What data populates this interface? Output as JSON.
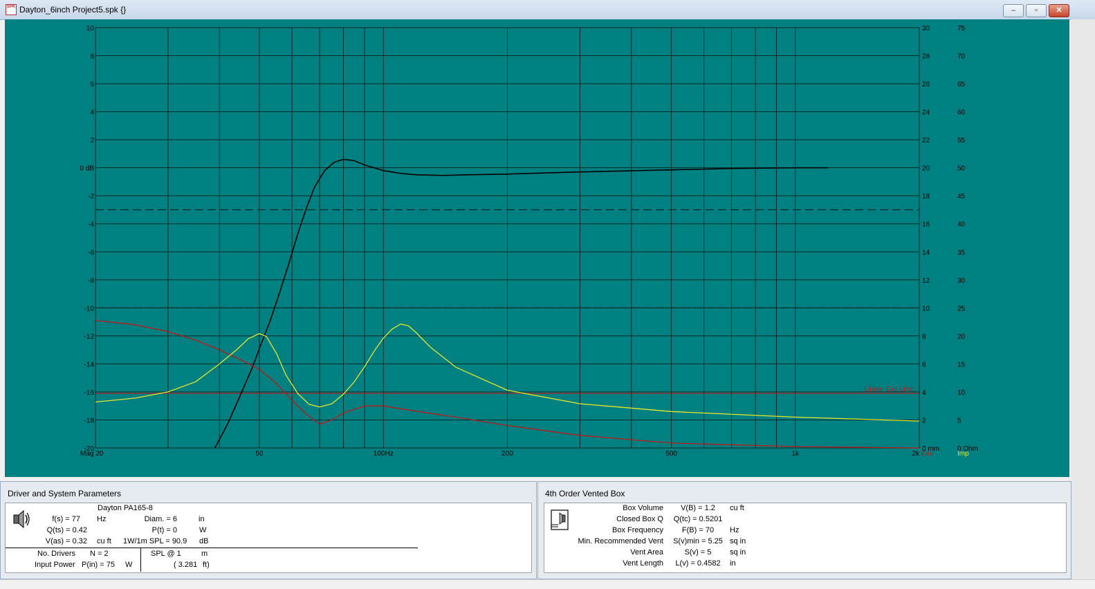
{
  "window": {
    "title": "Dayton_6inch Project5.spk {}",
    "minimize": "–",
    "restore": "▫",
    "close": "✕",
    "icon_text": "SPK"
  },
  "chart_data": {
    "type": "line",
    "x_scale": "log",
    "xlim": [
      20,
      2000
    ],
    "x_tick_labels": [
      "Mag 20",
      "50",
      "100Hz",
      "200",
      "500",
      "1k",
      "2k"
    ],
    "x_tick_values": [
      20,
      50,
      100,
      200,
      500,
      1000,
      2000
    ],
    "left_axis": {
      "unit_label": "dB",
      "ylim": [
        -20,
        10
      ],
      "tick_labels": [
        "10",
        "8",
        "6",
        "4",
        "2",
        "0 dB",
        "-2",
        "-4",
        "-6",
        "-8",
        "-10",
        "-12",
        "-14",
        "-16",
        "-18",
        "-20"
      ]
    },
    "excursion_axis": {
      "ylim": [
        0,
        30
      ],
      "tick_labels": [
        "30",
        "28",
        "26",
        "24",
        "22",
        "20",
        "18",
        "16",
        "14",
        "12",
        "10",
        "8",
        "6",
        "4",
        "2",
        "0 mm"
      ],
      "footer": "Exc"
    },
    "impedance_axis": {
      "ylim": [
        0,
        75
      ],
      "tick_labels": [
        "75",
        "70",
        "65",
        "60",
        "55",
        "50",
        "45",
        "40",
        "35",
        "30",
        "25",
        "20",
        "15",
        "10",
        "5",
        "0 Ohm"
      ],
      "footer": "Imp"
    },
    "reference_lines": {
      "minus3db": -3,
      "minus10db": -10
    },
    "linear_exc_limit": {
      "label": "Linear Exc Limit",
      "value_mm": 3.9
    },
    "colors": {
      "background": "#008080",
      "grid": "#0a2a2a",
      "magnitude": "#000000",
      "excursion": "#c0181a",
      "impedance": "#e8e82a",
      "limit": "#c0181a",
      "exc_label": "#c0181a",
      "imp_label": "#e8e82a"
    },
    "series": [
      {
        "key": "magnitude",
        "axis": "dB",
        "x": [
          39,
          42,
          45,
          48,
          50,
          53,
          56,
          59,
          62,
          65,
          68,
          72,
          76,
          80,
          85,
          90,
          100,
          110,
          120,
          140,
          160,
          200,
          300,
          500,
          700,
          1000,
          1200
        ],
        "y": [
          -20,
          -18.2,
          -16.2,
          -14.3,
          -12.9,
          -11,
          -8.9,
          -6.8,
          -4.7,
          -2.9,
          -1.4,
          -0.2,
          0.4,
          0.6,
          0.5,
          0.2,
          -0.2,
          -0.4,
          -0.5,
          -0.55,
          -0.5,
          -0.45,
          -0.3,
          -0.15,
          -0.05,
          0,
          0
        ]
      },
      {
        "key": "excursion",
        "axis": "mm",
        "x": [
          20,
          25,
          30,
          35,
          40,
          45,
          50,
          55,
          60,
          65,
          70,
          75,
          80,
          90,
          100,
          110,
          150,
          200,
          300,
          500,
          1000,
          2000
        ],
        "y": [
          9.1,
          8.8,
          8.3,
          7.7,
          7,
          6.3,
          5.6,
          4.6,
          3.4,
          2.4,
          1.7,
          2,
          2.5,
          3,
          3,
          2.8,
          2.2,
          1.6,
          0.9,
          0.35,
          0.1,
          0
        ]
      },
      {
        "key": "impedance",
        "axis": "Ohm",
        "x": [
          20,
          25,
          30,
          35,
          40,
          44,
          47,
          50,
          52,
          55,
          58,
          62,
          66,
          70,
          75,
          80,
          85,
          90,
          95,
          100,
          105,
          110,
          115,
          120,
          130,
          150,
          200,
          300,
          500,
          1000,
          2000
        ],
        "y": [
          8.2,
          8.9,
          10,
          11.8,
          15,
          17.5,
          19.5,
          20.4,
          19.9,
          16.9,
          13,
          9.7,
          7.8,
          7.3,
          7.9,
          9.6,
          11.8,
          14.5,
          17.3,
          19.6,
          21.2,
          22.1,
          21.8,
          20.6,
          18,
          14.4,
          10.3,
          7.9,
          6.5,
          5.5,
          4.8
        ]
      }
    ]
  },
  "driver_panel": {
    "title": "Driver and System Parameters",
    "driver_name": "Dayton PA165-8",
    "fs_label": "f(s) = 77",
    "fs_unit": "Hz",
    "diam_label": "Diam. = 6",
    "diam_unit": "in",
    "qts_label": "Q(ts) = 0.42",
    "pt_label": "P(t) = 0",
    "pt_unit": "W",
    "vas_label": "V(as) = 0.32",
    "vas_unit": "cu ft",
    "spl_label": "1W/1m SPL = 90.9",
    "spl_unit": "dB",
    "nd_label": "No. Drivers",
    "nd_value": "N = 2",
    "splat_label": "SPL @ 1",
    "splat_unit": "m",
    "ip_label": "Input Power",
    "ip_value": "P(in) = 75",
    "ip_unit": "W",
    "dist_ft": "( 3.281",
    "dist_unit": "ft)"
  },
  "box_panel": {
    "title": "4th Order Vented Box",
    "rows": [
      {
        "label": "Box Volume",
        "value": "V(B) = 1.2",
        "unit": "cu ft"
      },
      {
        "label": "Closed Box Q",
        "value": "Q(tc) = 0.5201",
        "unit": ""
      },
      {
        "label": "Box Frequency",
        "value": "F(B) = 70",
        "unit": "Hz"
      },
      {
        "label": "Min. Recommended Vent",
        "value": "S(v)min = 5.25",
        "unit": "sq in"
      },
      {
        "label": "Vent Area",
        "value": "S(v) = 5",
        "unit": "sq in"
      },
      {
        "label": "Vent Length",
        "value": "L(v) = 0.4582",
        "unit": "in"
      }
    ]
  }
}
